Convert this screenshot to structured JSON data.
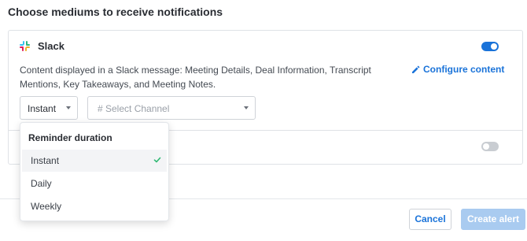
{
  "page": {
    "title": "Choose mediums to receive notifications"
  },
  "slack": {
    "name": "Slack",
    "enabled": true,
    "description": "Content displayed in a Slack message: Meeting Details, Deal Information, Transcript Mentions, Key Takeaways, and Meeting Notes.",
    "configure_label": "Configure content",
    "frequency_value": "Instant",
    "channel_placeholder": "# Select Channel"
  },
  "second_medium": {
    "enabled": false
  },
  "reminder_dropdown": {
    "heading": "Reminder duration",
    "options": [
      "Instant",
      "Daily",
      "Weekly"
    ],
    "selected": "Instant"
  },
  "footer": {
    "cancel_label": "Cancel",
    "create_label": "Create alert"
  },
  "colors": {
    "accent": "#1a73d9",
    "toggle_off": "#c9cdd2",
    "check": "#2eb872"
  }
}
